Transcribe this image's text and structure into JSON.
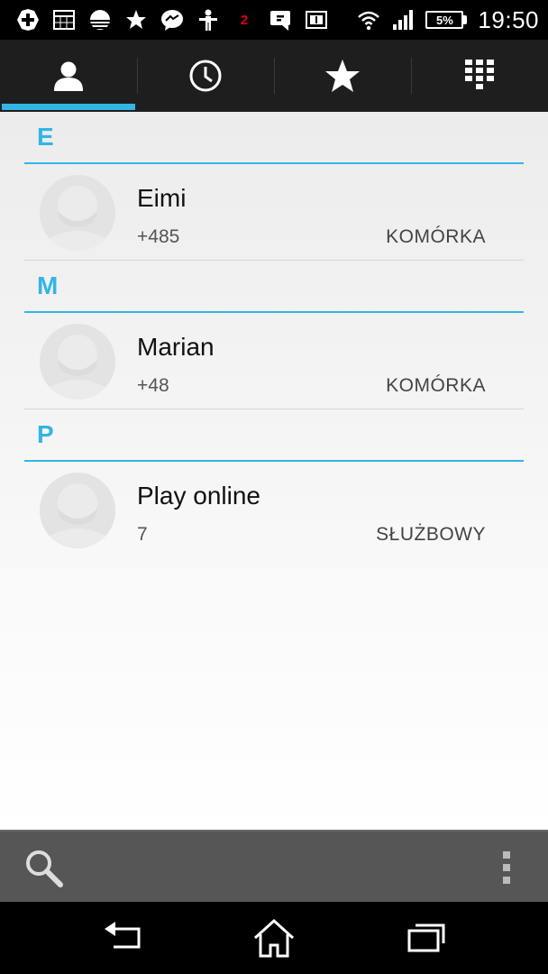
{
  "status_bar": {
    "left_icons": [
      "add-icon",
      "calendar-icon",
      "sunset-icon",
      "star-icon",
      "messenger-icon",
      "sports-icon",
      "notification-count-icon",
      "sms-icon",
      "news-icon"
    ],
    "badge": "2",
    "battery": "5%",
    "time": "19:50"
  },
  "tabs": [
    {
      "icon": "contacts-icon",
      "active": true
    },
    {
      "icon": "clock-icon",
      "active": false
    },
    {
      "icon": "star-icon",
      "active": false
    },
    {
      "icon": "dialpad-icon",
      "active": false
    }
  ],
  "contacts": {
    "sections": [
      {
        "letter": "E",
        "entries": [
          {
            "name": "Eimi",
            "number": "+485",
            "type": "KOMÓRKA"
          }
        ]
      },
      {
        "letter": "M",
        "entries": [
          {
            "name": "Marian",
            "number": "+48",
            "type": "KOMÓRKA"
          }
        ]
      },
      {
        "letter": "P",
        "entries": [
          {
            "name": "Play online",
            "number": "7",
            "type": "SŁUŻBOWY"
          }
        ]
      }
    ]
  },
  "action_bar": {
    "left_icon": "search-icon",
    "right_icon": "overflow-menu-icon"
  },
  "nav_bar": {
    "buttons": [
      "back-icon",
      "home-icon",
      "recents-icon"
    ]
  },
  "colors": {
    "accent": "#33b5e5",
    "tab_bar": "#1e1e1e",
    "action_bar": "#565656"
  }
}
